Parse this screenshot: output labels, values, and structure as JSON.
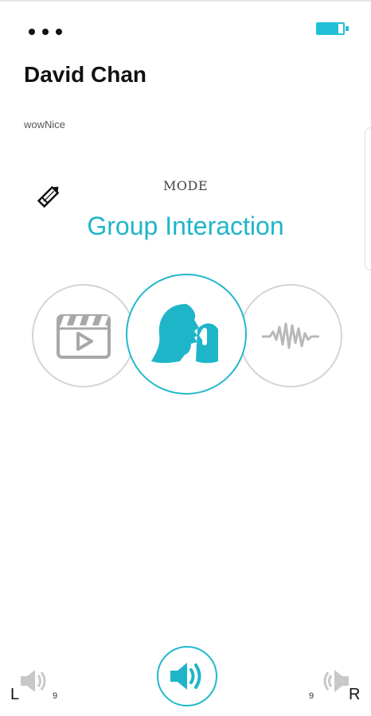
{
  "header": {
    "more_icon": "more-dots-icon",
    "battery_icon": "battery-icon",
    "title": "David Chan",
    "subtitle": "wowNice"
  },
  "mode": {
    "edit_icon": "pencil-icon",
    "label": "MODE",
    "name": "Group Interaction",
    "options": [
      {
        "icon": "video-clapperboard-icon",
        "selected": false
      },
      {
        "icon": "listener-person-icon",
        "selected": true
      },
      {
        "icon": "sound-wave-icon",
        "selected": false
      }
    ]
  },
  "footer": {
    "left": {
      "label": "L",
      "value": "9",
      "icon": "speaker-left-icon"
    },
    "right": {
      "label": "R",
      "value": "9",
      "icon": "speaker-right-icon"
    },
    "center_icon": "volume-icon"
  },
  "colors": {
    "accent": "#1fb5c9",
    "inactive": "#c8c8c8",
    "battery": "#22c0d8"
  }
}
